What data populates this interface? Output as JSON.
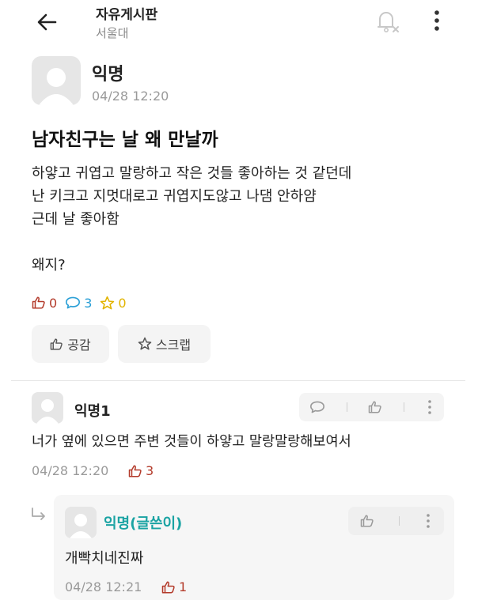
{
  "header": {
    "board_title": "자유게시판",
    "board_subtitle": "서울대",
    "icons": [
      "back-arrow-icon",
      "bell-off-icon",
      "more-vertical-icon"
    ]
  },
  "post": {
    "author": "익명",
    "time": "04/28 12:20",
    "title": "남자친구는 날 왜 만날까",
    "body_lines": [
      "하얗고 귀엽고 말랑하고 작은 것들 좋아하는 것 같던데",
      "난 키크고 지멋대로고 귀엽지도않고 나댐 안하얌",
      "근데 날 좋아함",
      "",
      "왜지?"
    ],
    "stats": {
      "likes": "0",
      "comments": "3",
      "scraps": "0"
    },
    "buttons": {
      "like": "공감",
      "scrap": "스크랩"
    }
  },
  "comments": [
    {
      "author": "익명1",
      "text": "너가 옆에 있으면 주변 것들이 하얗고 말랑말랑해보여서",
      "time": "04/28 12:20",
      "likes": "3",
      "reply": {
        "author": "익명(글쓴이)",
        "text": "개빡치네진짜",
        "time": "04/28 12:21",
        "likes": "1"
      }
    }
  ],
  "colors": {
    "like_red": "#b33a2a",
    "comment_blue": "#2a9fd6",
    "scrap_yellow": "#e2b400",
    "op_teal": "#1aa3a3"
  }
}
